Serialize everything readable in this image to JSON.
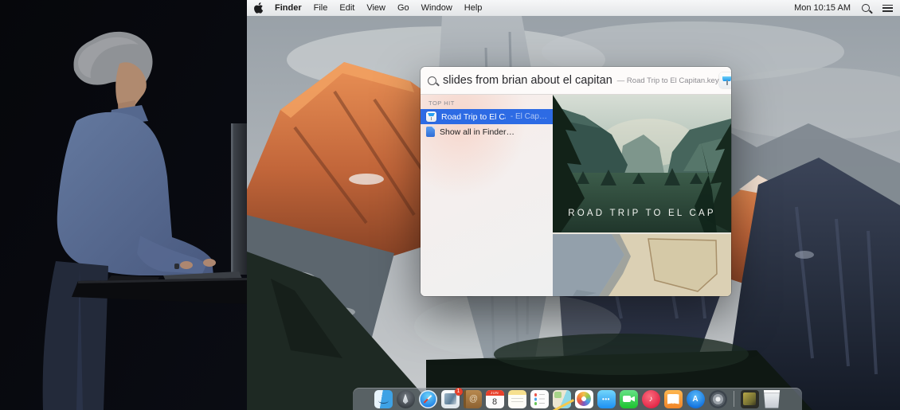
{
  "menu_bar": {
    "app_name": "Finder",
    "menus": [
      "File",
      "Edit",
      "View",
      "Go",
      "Window",
      "Help"
    ],
    "clock": "Mon 10:15 AM"
  },
  "spotlight": {
    "query": "slides from brian about el capitan",
    "completion": "— Road Trip to El Capitan.key",
    "section_header": "TOP HIT",
    "results": [
      {
        "name": "road-trip-to-el-capitan-key",
        "label": "Road Trip to El Capitan.key",
        "detail": "- El Cap…",
        "icon": "keynote-icon",
        "selected": true
      },
      {
        "name": "show-all-in-finder",
        "label": "Show all in Finder…",
        "detail": "",
        "icon": "finder-document-icon",
        "selected": false
      }
    ],
    "preview": {
      "slide1_title": "ROAD TRIP TO EL CAP"
    }
  },
  "dock": {
    "items": [
      {
        "name": "finder"
      },
      {
        "name": "launchpad"
      },
      {
        "name": "safari"
      },
      {
        "name": "mail",
        "badge": "1"
      },
      {
        "name": "contacts"
      },
      {
        "name": "calendar",
        "month": "JUN",
        "day": "8"
      },
      {
        "name": "notes"
      },
      {
        "name": "reminders"
      },
      {
        "name": "maps"
      },
      {
        "name": "photos"
      },
      {
        "name": "messages",
        "glyph": "•••"
      },
      {
        "name": "facetime"
      },
      {
        "name": "itunes",
        "glyph": "♪"
      },
      {
        "name": "ibooks"
      },
      {
        "name": "appstore",
        "glyph": "A"
      },
      {
        "name": "system-preferences"
      },
      {
        "name": "separator"
      },
      {
        "name": "stack"
      },
      {
        "name": "trash"
      }
    ]
  },
  "colors": {
    "selection_blue": "#2d6be4",
    "badge_red": "#e8402a",
    "keynote_blue": "#28a0f2",
    "menubar_text": "#1a1a1a",
    "dock_bg": "rgba(124,132,141,0.62)"
  }
}
